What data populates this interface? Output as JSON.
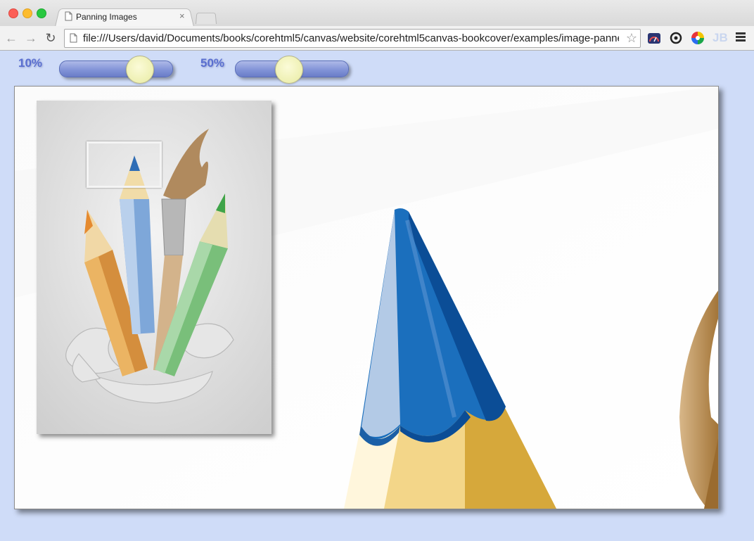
{
  "browser": {
    "tab_title": "Panning Images",
    "tab_close": "×",
    "url": "file:///Users/david/Documents/books/corehtml5/canvas/website/corehtml5canvas-bookcover/examples/image-panne…",
    "nav_back": "←",
    "nav_forward": "→",
    "nav_reload": "↻",
    "bookmark_star": "☆",
    "extension_jb": "JB"
  },
  "controls": {
    "overview_scale_label": "10%",
    "overview_scale_value": 0.77,
    "zoom_label": "50%",
    "zoom_value": 0.46
  },
  "canvas": {
    "background": "#ffffff",
    "overview_background": "#d4d4d4",
    "accent_blue": "#1b6fbd",
    "accent_dark_blue": "#0b4d96",
    "accent_light_blue": "#b3cae6",
    "pencil_yellow": "#f2d38c",
    "brush_brown": "#c69a5f"
  }
}
